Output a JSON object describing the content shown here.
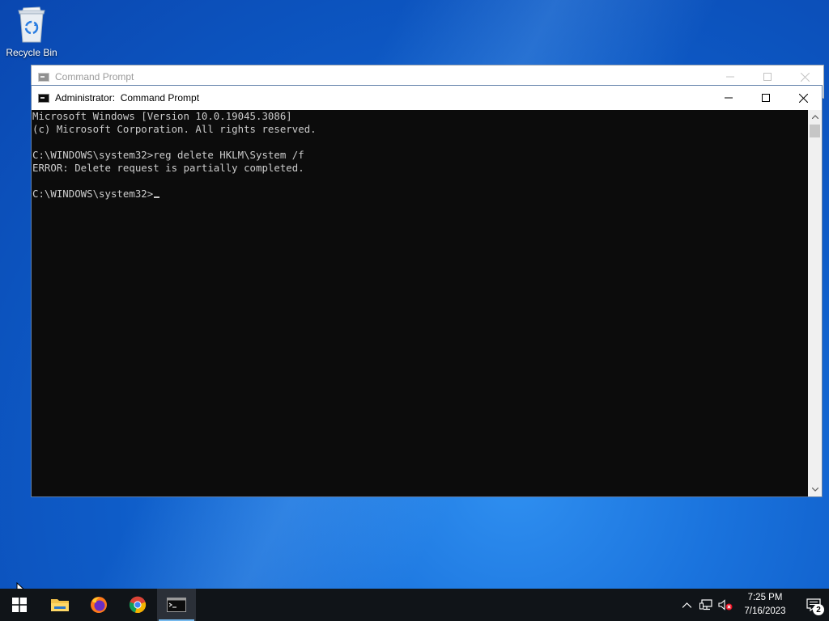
{
  "desktop": {
    "icons": [
      {
        "label": "Recycle Bin",
        "icon": "recycle-bin-icon"
      }
    ]
  },
  "background_window": {
    "title": "Command Prompt",
    "icon": "cmd-icon",
    "controls": [
      "minimize",
      "maximize",
      "close"
    ]
  },
  "active_window": {
    "title": "Administrator:  Command Prompt",
    "icon": "cmd-icon",
    "controls": [
      "minimize",
      "maximize",
      "close"
    ],
    "console_lines": [
      "Microsoft Windows [Version 10.0.19045.3086]",
      "(c) Microsoft Corporation. All rights reserved.",
      "",
      "C:\\WINDOWS\\system32>reg delete HKLM\\System /f",
      "ERROR: Delete request is partially completed.",
      "",
      "C:\\WINDOWS\\system32>"
    ],
    "console_colors": {
      "background": "#0c0c0c",
      "text": "#cccccc"
    }
  },
  "taskbar": {
    "items": [
      {
        "name": "start",
        "icon": "windows-logo-icon"
      },
      {
        "name": "file-explorer",
        "icon": "folder-icon"
      },
      {
        "name": "firefox",
        "icon": "firefox-icon"
      },
      {
        "name": "chrome",
        "icon": "chrome-icon"
      },
      {
        "name": "command-prompt",
        "icon": "cmd-icon",
        "active": true
      }
    ],
    "tray": {
      "icons": [
        "chevron-up-icon",
        "network-icon",
        "volume-muted-icon"
      ],
      "time": "7:25 PM",
      "date": "7/16/2023",
      "notification_count": "2"
    },
    "accent_color": "#76b9ed"
  }
}
